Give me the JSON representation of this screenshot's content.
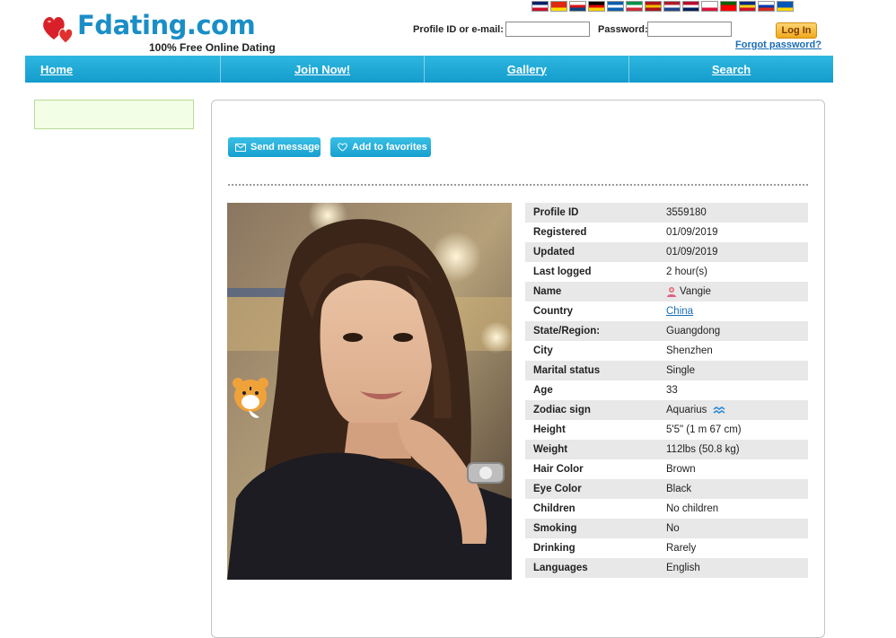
{
  "header": {
    "logo_text": "Fdating.com",
    "tagline": "100% Free Online Dating",
    "flags": [
      {
        "name": "uk-flag-icon",
        "colors": [
          "#012169",
          "#ffffff",
          "#c8102e"
        ]
      },
      {
        "name": "china-flag-icon",
        "colors": [
          "#de2910",
          "#de2910",
          "#ffde00"
        ]
      },
      {
        "name": "czech-flag-icon",
        "colors": [
          "#ffffff",
          "#d7141a",
          "#11457e"
        ]
      },
      {
        "name": "germany-flag-icon",
        "colors": [
          "#000000",
          "#dd0000",
          "#ffce00"
        ]
      },
      {
        "name": "greece-flag-icon",
        "colors": [
          "#0d5eaf",
          "#ffffff",
          "#0d5eaf"
        ]
      },
      {
        "name": "italy-flag-icon",
        "colors": [
          "#009246",
          "#ffffff",
          "#ce2b37"
        ]
      },
      {
        "name": "spain-flag-icon",
        "colors": [
          "#aa151b",
          "#f1bf00",
          "#aa151b"
        ]
      },
      {
        "name": "netherlands-flag-icon",
        "colors": [
          "#ae1c28",
          "#ffffff",
          "#21468b"
        ]
      },
      {
        "name": "norway-flag-icon",
        "colors": [
          "#ba0c2f",
          "#ffffff",
          "#00205b"
        ]
      },
      {
        "name": "poland-flag-icon",
        "colors": [
          "#ffffff",
          "#ffffff",
          "#dc143c"
        ]
      },
      {
        "name": "portugal-flag-icon",
        "colors": [
          "#006600",
          "#ff0000",
          "#ff0000"
        ]
      },
      {
        "name": "romania-flag-icon",
        "colors": [
          "#002b7f",
          "#fcd116",
          "#ce1126"
        ]
      },
      {
        "name": "russia-flag-icon",
        "colors": [
          "#ffffff",
          "#0039a6",
          "#d52b1e"
        ]
      },
      {
        "name": "ukraine-flag-icon",
        "colors": [
          "#0057b7",
          "#0057b7",
          "#ffd700"
        ]
      }
    ]
  },
  "login": {
    "id_label": "Profile ID or e-mail:",
    "id_value": "",
    "password_label": "Password:",
    "password_value": "",
    "login_button": "Log In",
    "forgot": "Forgot password?"
  },
  "nav": {
    "items": [
      "Home",
      "Join Now!",
      "Gallery",
      "Search"
    ]
  },
  "actions": {
    "send_message": "Send message",
    "add_favorites": "Add to favorites"
  },
  "profile": {
    "rows": [
      {
        "label": "Profile ID",
        "value": "3559180"
      },
      {
        "label": "Registered",
        "value": "01/09/2019"
      },
      {
        "label": "Updated",
        "value": "01/09/2019"
      },
      {
        "label": "Last logged",
        "value": "2 hour(s)"
      },
      {
        "label": "Name",
        "value": "Vangie",
        "icon": "female-user-icon"
      },
      {
        "label": "Country",
        "value": "China",
        "link": true
      },
      {
        "label": "State/Region:",
        "value": "Guangdong"
      },
      {
        "label": "City",
        "value": "Shenzhen"
      },
      {
        "label": "Marital status",
        "value": "Single"
      },
      {
        "label": "Age",
        "value": "33"
      },
      {
        "label": "Zodiac sign",
        "value": "Aquarius",
        "icon": "aquarius-icon"
      },
      {
        "label": "Height",
        "value": "5'5\" (1 m 67 cm)"
      },
      {
        "label": "Weight",
        "value": "112lbs (50.8 kg)"
      },
      {
        "label": "Hair Color",
        "value": "Brown"
      },
      {
        "label": "Eye Color",
        "value": "Black"
      },
      {
        "label": "Children",
        "value": "No children"
      },
      {
        "label": "Smoking",
        "value": "No"
      },
      {
        "label": "Drinking",
        "value": "Rarely"
      },
      {
        "label": "Languages",
        "value": "English"
      }
    ]
  },
  "colors": {
    "brand_blue": "#1a8ec6",
    "nav_blue": "#149ccd",
    "link_blue": "#1a6db6",
    "login_orange": "#f1a91d"
  }
}
